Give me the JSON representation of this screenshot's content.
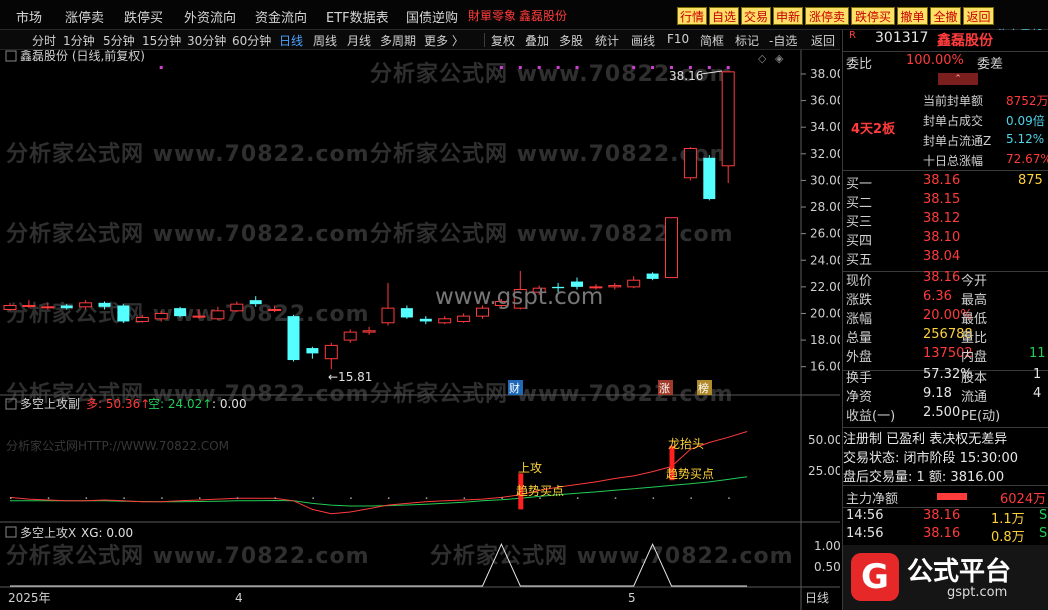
{
  "menu": {
    "items": [
      "市场",
      "涨停卖",
      "跌停买",
      "外资流向",
      "资金流向",
      "ETF数据表",
      "国债逆购",
      "財單零象",
      "鑫磊股份"
    ],
    "buttons": [
      "行情",
      "自选",
      "交易",
      "申新",
      "涨停卖",
      "跌停买",
      "撤单",
      "全撤",
      "返回"
    ],
    "tail": "汽车零部"
  },
  "toolbar": {
    "left": [
      "分时",
      "1分钟",
      "5分钟",
      "15分钟",
      "30分钟",
      "60分钟",
      "日线",
      "周线",
      "月线",
      "多周期",
      "更多 〉"
    ],
    "right": [
      "复权",
      "叠加",
      "多股",
      "统计",
      "画线",
      "F10",
      "简框",
      "标记",
      "-自选",
      "返回"
    ],
    "active": "日线"
  },
  "main_chart": {
    "title": "鑫磊股份 (日线,前复权)",
    "high_label": "38.16",
    "low_label": "←15.81",
    "y_ticks": [
      "38.00",
      "36.00",
      "34.00",
      "32.00",
      "30.00",
      "28.00",
      "26.00",
      "24.00",
      "22.00",
      "20.00",
      "18.00",
      "16.00"
    ],
    "markers": [
      "财",
      "涨",
      "榜"
    ],
    "watermark": "www.gspt.com"
  },
  "indicator1": {
    "name": "多空上攻副",
    "duo_label": "多: 50.36↑",
    "kong_label": "空: 24.02↑",
    "extra": ": 0.00",
    "y_ticks": [
      "50.00",
      "25.00"
    ],
    "signals": [
      "上攻",
      "趋势买点",
      "龙抬头",
      "趋势买点"
    ],
    "wm_small": "分析家公式网HTTP://WWW.70822.COM"
  },
  "indicator2": {
    "name": "多空上攻X",
    "xg_label": "XG: 0.00",
    "y_ticks": [
      "1.00",
      "0.50"
    ]
  },
  "x_axis": {
    "labels": [
      "2025年",
      "4",
      "5"
    ],
    "period": "日线"
  },
  "watermark_text": "分析家公式网  www.70822.com",
  "chart_data": {
    "type": "candlestick",
    "ylim": [
      15.0,
      38.6
    ],
    "candles": [
      {
        "o": 20.3,
        "c": 20.6,
        "h": 20.8,
        "l": 20.2
      },
      {
        "o": 20.6,
        "c": 20.6,
        "h": 21.0,
        "l": 20.4
      },
      {
        "o": 20.5,
        "c": 20.5,
        "h": 20.8,
        "l": 20.3
      },
      {
        "o": 20.6,
        "c": 20.4,
        "h": 20.7,
        "l": 20.3
      },
      {
        "o": 20.5,
        "c": 20.8,
        "h": 21.0,
        "l": 20.3
      },
      {
        "o": 20.8,
        "c": 20.5,
        "h": 20.9,
        "l": 20.3
      },
      {
        "o": 20.6,
        "c": 19.4,
        "h": 20.7,
        "l": 19.3
      },
      {
        "o": 19.4,
        "c": 19.7,
        "h": 19.9,
        "l": 19.3
      },
      {
        "o": 19.6,
        "c": 20.0,
        "h": 20.2,
        "l": 19.4
      },
      {
        "o": 20.4,
        "c": 19.8,
        "h": 20.5,
        "l": 19.7
      },
      {
        "o": 19.8,
        "c": 19.8,
        "h": 20.3,
        "l": 19.6
      },
      {
        "o": 19.6,
        "c": 20.2,
        "h": 20.5,
        "l": 19.5
      },
      {
        "o": 20.2,
        "c": 20.7,
        "h": 20.9,
        "l": 20.1
      },
      {
        "o": 21.0,
        "c": 20.7,
        "h": 21.3,
        "l": 20.5
      },
      {
        "o": 20.3,
        "c": 20.3,
        "h": 20.6,
        "l": 20.1
      },
      {
        "o": 19.8,
        "c": 16.5,
        "h": 19.9,
        "l": 16.4
      },
      {
        "o": 17.4,
        "c": 17.0,
        "h": 17.5,
        "l": 16.6
      },
      {
        "o": 16.6,
        "c": 17.6,
        "h": 17.8,
        "l": 15.81
      },
      {
        "o": 18.0,
        "c": 18.6,
        "h": 18.8,
        "l": 17.8
      },
      {
        "o": 18.6,
        "c": 18.7,
        "h": 19.0,
        "l": 18.4
      },
      {
        "o": 19.3,
        "c": 20.4,
        "h": 22.3,
        "l": 19.1
      },
      {
        "o": 20.4,
        "c": 19.7,
        "h": 20.6,
        "l": 19.6
      },
      {
        "o": 19.6,
        "c": 19.4,
        "h": 19.8,
        "l": 19.2
      },
      {
        "o": 19.3,
        "c": 19.6,
        "h": 19.8,
        "l": 19.2
      },
      {
        "o": 19.4,
        "c": 19.8,
        "h": 20.0,
        "l": 19.3
      },
      {
        "o": 19.8,
        "c": 20.4,
        "h": 20.6,
        "l": 19.6
      },
      {
        "o": 20.6,
        "c": 20.9,
        "h": 21.1,
        "l": 20.4
      },
      {
        "o": 20.4,
        "c": 21.8,
        "h": 23.2,
        "l": 20.3
      },
      {
        "o": 21.6,
        "c": 21.9,
        "h": 22.1,
        "l": 21.4
      },
      {
        "o": 22.0,
        "c": 21.9,
        "h": 22.3,
        "l": 21.6
      },
      {
        "o": 22.4,
        "c": 22.0,
        "h": 22.7,
        "l": 21.8
      },
      {
        "o": 22.0,
        "c": 22.0,
        "h": 22.2,
        "l": 21.8
      },
      {
        "o": 22.0,
        "c": 22.1,
        "h": 22.3,
        "l": 21.8
      },
      {
        "o": 22.0,
        "c": 22.5,
        "h": 22.8,
        "l": 21.9
      },
      {
        "o": 23.0,
        "c": 22.6,
        "h": 23.1,
        "l": 22.5
      },
      {
        "o": 22.7,
        "c": 27.2,
        "h": 27.2,
        "l": 22.7
      },
      {
        "o": 30.2,
        "c": 32.4,
        "h": 32.5,
        "l": 30.0
      },
      {
        "o": 31.7,
        "c": 28.6,
        "h": 31.9,
        "l": 28.5
      },
      {
        "o": 31.1,
        "c": 38.16,
        "h": 38.16,
        "l": 29.8
      }
    ],
    "indicator1": {
      "ylim": [
        0,
        60
      ],
      "duo": [
        12,
        11,
        10.5,
        10,
        10,
        10.5,
        10,
        9.5,
        9.5,
        10,
        10.5,
        11,
        11.5,
        11.5,
        11.5,
        10,
        5,
        2.5,
        3.5,
        5.5,
        7.5,
        8.5,
        9.5,
        10,
        10.5,
        11,
        12,
        13.5,
        16,
        18,
        19.5,
        21,
        23,
        24.5,
        27,
        30,
        40,
        44,
        47,
        50.36
      ],
      "kong": [
        10,
        10,
        10,
        10,
        10,
        10,
        9.8,
        9.6,
        9.5,
        9.5,
        9.6,
        9.8,
        10,
        10.1,
        10.2,
        10,
        8.5,
        7.5,
        7,
        7,
        7.2,
        7.6,
        8,
        8.6,
        9.2,
        10,
        10.6,
        11.5,
        12.6,
        13.5,
        14.4,
        15.2,
        16.2,
        17,
        18,
        19,
        20,
        21,
        22.5,
        24.02
      ],
      "signal_bars": [
        {
          "i": 27,
          "from": 5,
          "to": 26
        },
        {
          "i": 35,
          "from": 22,
          "to": 42
        }
      ]
    },
    "indicator2": {
      "ylim": [
        0,
        1.1
      ],
      "xg": [
        0,
        0,
        0,
        0,
        0,
        0,
        0,
        0,
        0,
        0,
        0,
        0,
        0,
        0,
        0,
        0,
        0,
        0,
        0,
        0,
        0,
        0,
        0,
        0,
        0,
        0,
        1,
        0,
        0,
        0,
        0,
        0,
        0,
        0,
        1,
        0,
        0,
        0,
        0,
        0
      ]
    }
  },
  "right_panel": {
    "flag": "R",
    "code": "301317",
    "name": "鑫磊股份",
    "wei_bi": {
      "label": "委比",
      "val": "100.00%",
      "label2": "委差"
    },
    "streak": "4天2板",
    "stats": [
      {
        "label": "当前封单额",
        "val": "8752万",
        "cls": "red"
      },
      {
        "label": "封单占成交",
        "val": "0.09倍",
        "cls": "cyan"
      },
      {
        "label": "封单占流通Z",
        "val": "5.12%",
        "cls": "cyan"
      },
      {
        "label": "十日总涨幅",
        "val": "72.67%",
        "cls": "red"
      }
    ],
    "bids": [
      {
        "label": "买一",
        "price": "38.16",
        "vol": "875"
      },
      {
        "label": "买二",
        "price": "38.15",
        "vol": ""
      },
      {
        "label": "买三",
        "price": "38.12",
        "vol": ""
      },
      {
        "label": "买四",
        "price": "38.10",
        "vol": ""
      },
      {
        "label": "买五",
        "price": "38.04",
        "vol": ""
      }
    ],
    "quote": [
      {
        "l1": "现价",
        "v1": "38.16",
        "c1": "red",
        "l2": "今开",
        "v2": "",
        "c2": "red"
      },
      {
        "l1": "涨跌",
        "v1": "6.36",
        "c1": "red",
        "l2": "最高",
        "v2": "",
        "c2": "red"
      },
      {
        "l1": "涨幅",
        "v1": "20.00%",
        "c1": "red",
        "l2": "最低",
        "v2": "",
        "c2": "red"
      },
      {
        "l1": "总量",
        "v1": "256788",
        "c1": "yellow",
        "l2": "量比",
        "v2": "",
        "c2": "red"
      },
      {
        "l1": "外盘",
        "v1": "137502",
        "c1": "red",
        "l2": "内盘",
        "v2": "11",
        "c2": "green"
      }
    ],
    "quote2": [
      {
        "l1": "换手",
        "v1": "57.32%",
        "l2": "股本",
        "v2": "1"
      },
      {
        "l1": "净资",
        "v1": "9.18",
        "l2": "流通",
        "v2": "4"
      },
      {
        "l1": "收益(一)",
        "v1": "2.500",
        "l2": "PE(动)",
        "v2": ""
      }
    ],
    "info": [
      "注册制 已盈利 表决权无差异",
      "交易状态: 闭市阶段 15:30:00",
      "盘后交易量: 1  额: 3816.00"
    ],
    "net_flow": {
      "label": "主力净额",
      "val": "6024万"
    },
    "ticks": [
      {
        "time": "14:56",
        "price": "38.16",
        "vol": "1.1万",
        "dir": "S"
      },
      {
        "time": "14:56",
        "price": "38.16",
        "vol": "0.8万",
        "dir": "S"
      }
    ],
    "logo": {
      "cn": "公式平台",
      "en": "gspt.com"
    }
  }
}
